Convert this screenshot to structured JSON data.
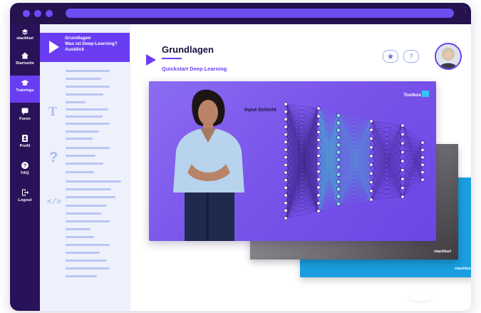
{
  "brand": "stackfuel",
  "nav": [
    {
      "label": "Startseite",
      "icon": "home-icon"
    },
    {
      "label": "Trainings",
      "icon": "graduation-cap-icon",
      "active": true
    },
    {
      "label": "Foren",
      "icon": "chat-icon"
    },
    {
      "label": "Profil",
      "icon": "user-icon"
    },
    {
      "label": "FAQ",
      "icon": "help-icon"
    },
    {
      "label": "Logout",
      "icon": "logout-icon"
    }
  ],
  "chapter": {
    "label": "Grundlagen\nWas ist Deep-Learning? Ausblick"
  },
  "main": {
    "title": "Grundlagen",
    "subtitle": "Quickstart Deep Learning"
  },
  "video": {
    "layer_label": "Input-Schicht",
    "toolbox_label": "Toolbox"
  },
  "cards": {
    "gray_brand": "stackfuel",
    "blue_brand": "stackfuel"
  },
  "colors": {
    "accent": "#6a3df2",
    "sidebar": "#2a1258",
    "titlebar": "#25124f"
  }
}
